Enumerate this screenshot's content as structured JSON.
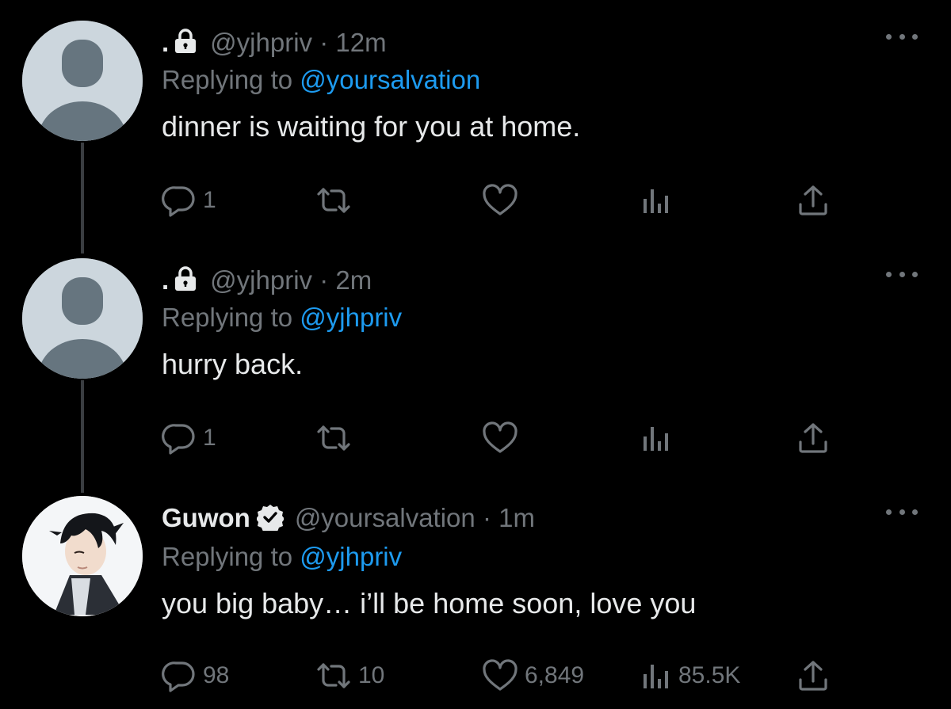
{
  "colors": {
    "background": "#000000",
    "text": "#e7e9ea",
    "muted": "#71767b",
    "link": "#1d9bf0",
    "thread_line": "#3a3d41"
  },
  "tweets": [
    {
      "display_name": ".",
      "protected_icon": "lock-icon",
      "handle": "@yjhpriv",
      "separator": "·",
      "time": "12m",
      "replying_prefix": "Replying to",
      "replying_to": "@yoursalvation",
      "text": "dinner is waiting for you at home.",
      "replies": "1",
      "retweets": "",
      "likes": "",
      "views": ""
    },
    {
      "display_name": ".",
      "protected_icon": "lock-icon",
      "handle": "@yjhpriv",
      "separator": "·",
      "time": "2m",
      "replying_prefix": "Replying to",
      "replying_to": "@yjhpriv",
      "text": "hurry back.",
      "replies": "1",
      "retweets": "",
      "likes": "",
      "views": ""
    },
    {
      "display_name": "Guwon",
      "verified_icon": "verified-badge-icon",
      "handle": "@yoursalvation",
      "separator": "·",
      "time": "1m",
      "replying_prefix": "Replying to",
      "replying_to": "@yjhpriv",
      "text": "you big baby… i’ll be home soon, love you",
      "replies": "98",
      "retweets": "10",
      "likes": "6,849",
      "views": "85.5K"
    }
  ]
}
